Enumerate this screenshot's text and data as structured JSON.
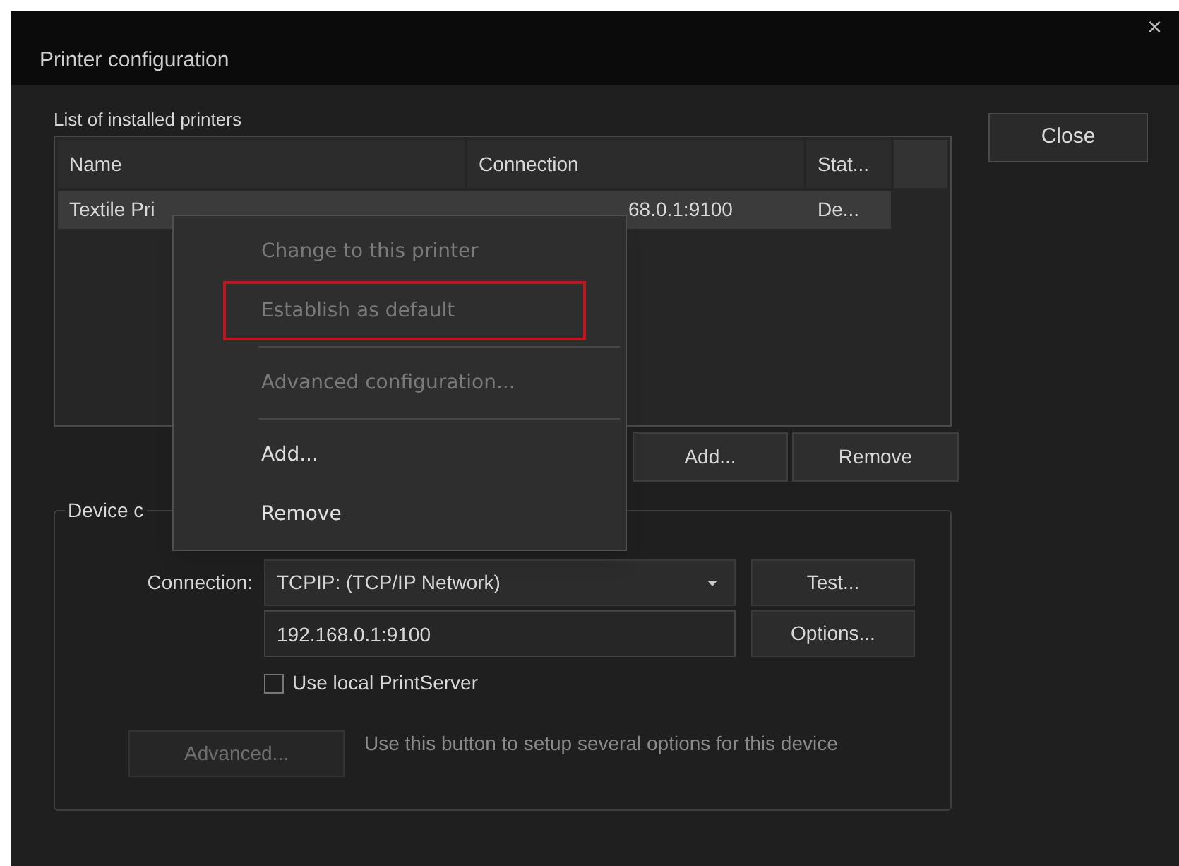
{
  "window": {
    "title": "Printer configuration",
    "close": "×"
  },
  "printers": {
    "label": "List of installed printers",
    "columns": [
      "Name",
      "Connection",
      "Stat..."
    ],
    "rows": [
      {
        "cells": [
          "Textile Pri",
          "68.0.1:9100",
          "De..."
        ],
        "selected": true
      }
    ]
  },
  "list_buttons": [
    "Add...",
    "Remove"
  ],
  "close_button": "Close",
  "device": {
    "label": "Device c",
    "connection_label": "Connection:",
    "connection_value": "TCPIP: (TCP/IP Network)",
    "address": "192.168.0.1:9100",
    "test_button": "Test...",
    "options_button": "Options...",
    "local_server": {
      "label": "Use local PrintServer",
      "checked": false
    },
    "advanced_button": {
      "label": "Advanced...",
      "disabled": true
    },
    "advanced_help": "Use this button to setup several options for this device"
  },
  "context_menu": [
    {
      "kind": "item",
      "label": "Change to this printer",
      "disabled": true,
      "outlined": false
    },
    {
      "kind": "item",
      "label": "Establish as default",
      "disabled": true,
      "outlined": true
    },
    {
      "kind": "separator"
    },
    {
      "kind": "item",
      "label": "Advanced configuration...",
      "disabled": true,
      "outlined": false
    },
    {
      "kind": "separator"
    },
    {
      "kind": "item",
      "label": "Add...",
      "disabled": false,
      "outlined": false
    },
    {
      "kind": "item",
      "label": "Remove",
      "disabled": false,
      "outlined": false
    }
  ]
}
